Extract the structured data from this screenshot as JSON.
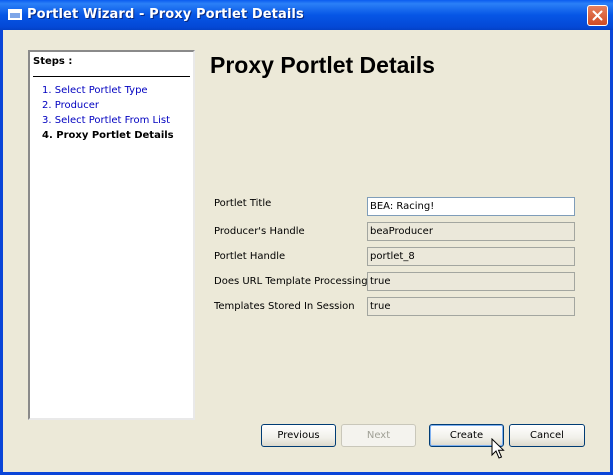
{
  "window": {
    "title": "Portlet Wizard - Proxy Portlet Details",
    "title_icon": "window-icon",
    "close_icon": "close-icon"
  },
  "steps": {
    "heading": "Steps :",
    "items": [
      {
        "label": "1. Select Portlet Type",
        "current": false
      },
      {
        "label": "2. Producer",
        "current": false
      },
      {
        "label": "3. Select Portlet From List",
        "current": false
      },
      {
        "label": "4. Proxy Portlet Details",
        "current": true
      }
    ]
  },
  "page": {
    "title": "Proxy Portlet Details"
  },
  "fields": [
    {
      "label": "Portlet Title",
      "value": "BEA: Racing!",
      "editable": true
    },
    {
      "label": "Producer's Handle",
      "value": "beaProducer",
      "editable": false
    },
    {
      "label": "Portlet Handle",
      "value": "portlet_8",
      "editable": false
    },
    {
      "label": "Does URL Template Processing",
      "value": "true",
      "editable": false
    },
    {
      "label": "Templates Stored In Session",
      "value": "true",
      "editable": false
    }
  ],
  "buttons": {
    "previous": "Previous",
    "next": "Next",
    "create": "Create",
    "cancel": "Cancel"
  },
  "colors": {
    "titlebar": "#0a5cf0",
    "link": "#0000c0",
    "background": "#ece9d8"
  }
}
